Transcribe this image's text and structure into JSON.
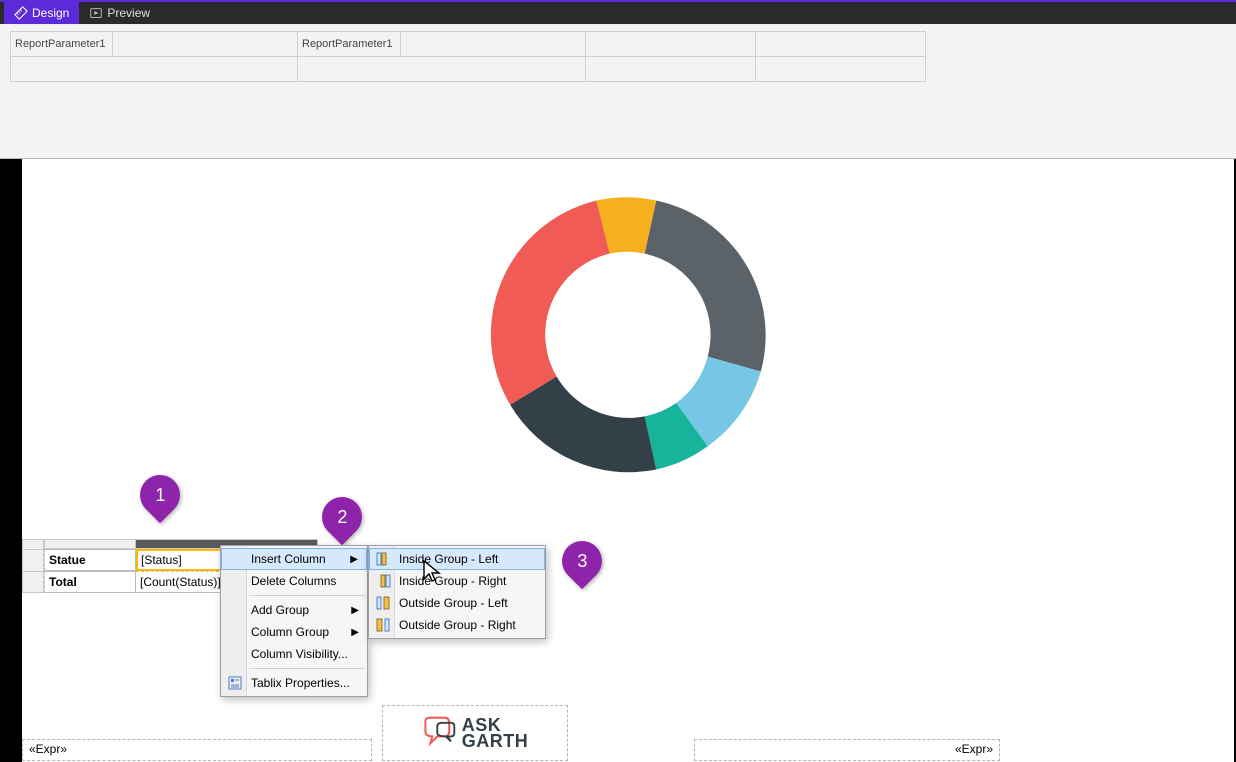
{
  "tabs": {
    "design": "Design",
    "preview": "Preview"
  },
  "params": {
    "label1": "ReportParameter1",
    "label2": "ReportParameter1"
  },
  "tablix": {
    "header_col0": "Statue",
    "header_col1": "[Status]",
    "row2_col0": "Total",
    "row2_col1": "[Count(Status)]"
  },
  "callouts": {
    "a": "1",
    "b": "2",
    "c": "3"
  },
  "context_menu": {
    "insert_column": "Insert Column",
    "delete_columns": "Delete Columns",
    "add_group": "Add Group",
    "column_group": "Column Group",
    "column_visibility": "Column Visibility...",
    "tablix_properties": "Tablix Properties..."
  },
  "submenu": {
    "inside_left": "Inside Group - Left",
    "inside_right": "Inside Group - Right",
    "outside_left": "Outside Group - Left",
    "outside_right": "Outside Group - Right"
  },
  "footer": {
    "expr_left": "«Expr»",
    "expr_right": "«Expr»",
    "logo_line1": "ASK",
    "logo_line2": "GARTH"
  },
  "chart_data": {
    "type": "pie",
    "donut": true,
    "series": [
      {
        "name": "segment-grey-top",
        "value": 26,
        "color": "#5b6268"
      },
      {
        "name": "segment-lightblue",
        "value": 13,
        "color": "#76c7e5"
      },
      {
        "name": "segment-teal",
        "value": 7,
        "color": "#18b39b"
      },
      {
        "name": "segment-darkslate",
        "value": 22,
        "color": "#334047"
      },
      {
        "name": "segment-red",
        "value": 28,
        "color": "#f15b56"
      },
      {
        "name": "segment-yellow",
        "value": 4,
        "color": "#f6b01e"
      }
    ],
    "inner_radius_pct": 50
  }
}
